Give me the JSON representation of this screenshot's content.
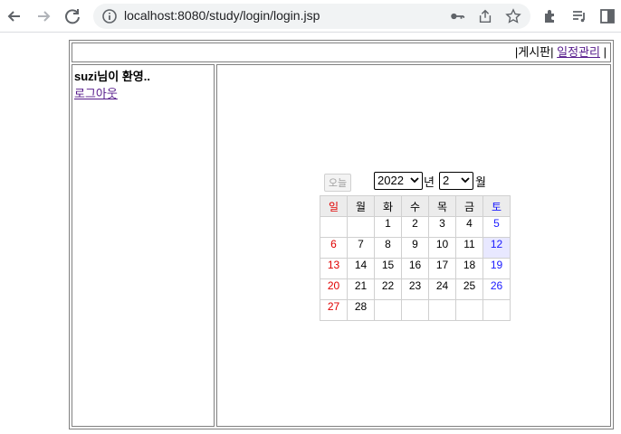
{
  "browser": {
    "url": "localhost:8080/study/login/login.jsp"
  },
  "topnav": {
    "sep_left": "|",
    "board": "게시판",
    "sep_mid": "|",
    "schedule": "일정관리",
    "sep_right": "|"
  },
  "sidebar": {
    "welcome": "suzi님이 환영..",
    "logout": "로그아웃"
  },
  "calendar": {
    "today_button": "오늘",
    "year": "2022",
    "year_unit": "년",
    "month": "2",
    "month_unit": "월",
    "weekdays": [
      "일",
      "월",
      "화",
      "수",
      "목",
      "금",
      "토"
    ],
    "weeks": [
      [
        "",
        "",
        "1",
        "2",
        "3",
        "4",
        "5"
      ],
      [
        "6",
        "7",
        "8",
        "9",
        "10",
        "11",
        "12"
      ],
      [
        "13",
        "14",
        "15",
        "16",
        "17",
        "18",
        "19"
      ],
      [
        "20",
        "21",
        "22",
        "23",
        "24",
        "25",
        "26"
      ],
      [
        "27",
        "28",
        "",
        "",
        "",
        "",
        ""
      ]
    ],
    "highlight_day": "12",
    "colors": {
      "sunday": "#e00000",
      "saturday": "#1a1aff",
      "highlight": "#e8e8ff"
    }
  }
}
